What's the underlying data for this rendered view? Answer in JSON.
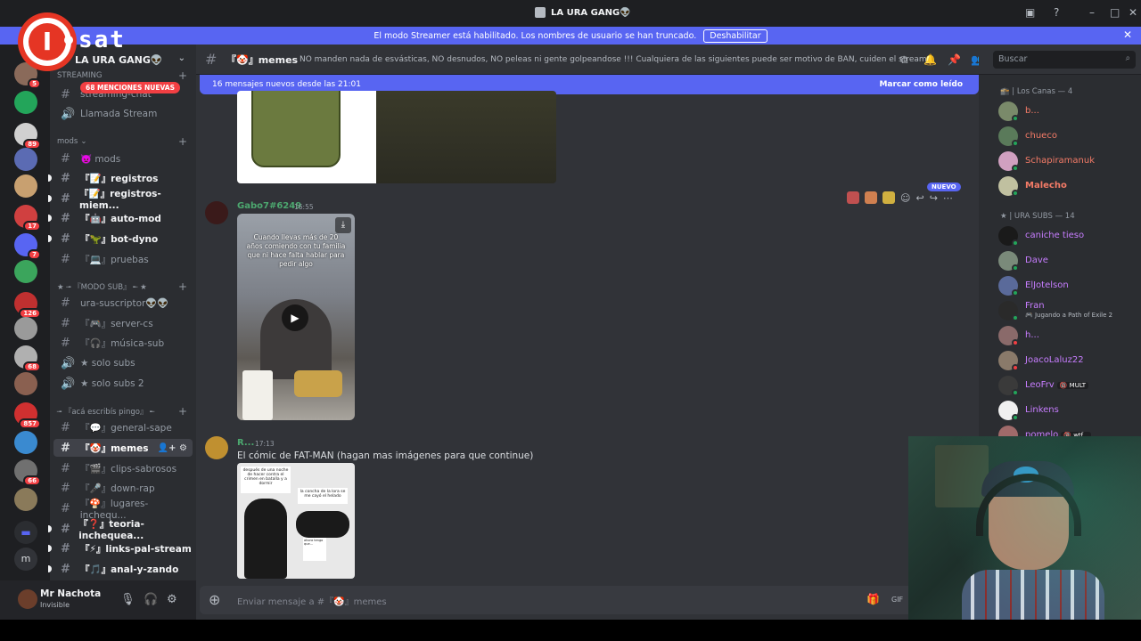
{
  "window": {
    "title": "LA URA GANG👽"
  },
  "banner": {
    "text": "El modo Streamer está habilitado. Los nombres de usuario se han truncado.",
    "button": "Deshabilitar"
  },
  "overlay_logo": {
    "letter": "I",
    "text": "sat"
  },
  "servers": [
    {
      "badge": "5",
      "color": "#8a6a5a"
    },
    {
      "badge": "",
      "color": "#23a55a"
    },
    {
      "badge": "89",
      "color": "#d0d0d0"
    },
    {
      "badge": "",
      "color": "#5b6bb3"
    },
    {
      "badge": "",
      "color": "#c8a070"
    },
    {
      "badge": "17",
      "color": "#d04040"
    },
    {
      "badge": "7",
      "color": "#5865f2"
    },
    {
      "badge": "",
      "color": "#3ba55c"
    },
    {
      "badge": "126",
      "color": "#c03030"
    },
    {
      "badge": "",
      "color": "#9a9a9a"
    },
    {
      "badge": "68",
      "color": "#b0b0b0"
    },
    {
      "badge": "",
      "color": "#8a6050"
    },
    {
      "badge": "857",
      "color": "#d03030"
    },
    {
      "badge": "",
      "color": "#3a8ad0"
    },
    {
      "badge": "66",
      "color": "#707070"
    },
    {
      "badge": "",
      "color": "#8a7a5a"
    }
  ],
  "sidebar": {
    "server_name": "LA URA GANG👽",
    "mentions_pill": "68 MENCIONES NUEVAS",
    "categories": {
      "streaming": "STREAMING",
      "mods": "mods",
      "modo_sub": "★ ╼ 『MODO SUB』 ╾ ★",
      "aca": "╼ 『acá escribís pingo』 ╾"
    },
    "channels": {
      "streaming_chat": "streaming-chat",
      "llamada_stream": "Llamada Stream",
      "mods": "👿 mods",
      "registros": "『📝』registros",
      "registros_miem": "『📝』registros-miem...",
      "auto_mod": "『🤖』auto-mod",
      "bot_dyno": "『🦖』bot-dyno",
      "pruebas": "『💻』pruebas",
      "ura_suscriptor": "ura-suscriptor👽👽",
      "server_cs": "『🎮』server-cs",
      "musica_sub": "『🎧』música-sub",
      "solo_subs": "★ solo subs",
      "solo_subs_2": "★ solo subs 2",
      "general_sape": "『💬』general-sape",
      "memes": "『🤡』memes",
      "clips_sabrosos": "『🎬』clips-sabrosos",
      "down_rap": "『🎤』down-rap",
      "lugares": "『🍄』lugares-inchequ...",
      "teoria": "『❓』teoria-inchequea...",
      "links": "『⚡』links-pal-stream",
      "anal": "『🎵』anal-y-zando"
    }
  },
  "user": {
    "name": "Mr Nachota",
    "status": "Invisible"
  },
  "header": {
    "channel": "『🤡』memes",
    "topic": "NO manden nada de esvásticas, NO desnudos, NO peleas ni gente golpeandose !!! Cualquiera de las siguientes puede ser motivo de BAN, cuiden el stream!",
    "search_placeholder": "Buscar"
  },
  "new_messages": {
    "text": "16 mensajes nuevos desde las 21:01",
    "mark_read": "Marcar como leído"
  },
  "messages": [
    {
      "author": "Gabo7#6249",
      "time": "16:55",
      "video_caption": "Cuando llevas más de 20 años comiendo con tu familia que ni hace falta hablar para pedir algo",
      "new_label": "NUEVO"
    },
    {
      "author": "R...",
      "time": "17:13",
      "text": "El cómic de FAT-MAN (hagan mas imágenes para que continue)",
      "comic_panel1": "después de una noche de hacer contra el crimen en batalla y a dormir",
      "comic_panel2": "la concha de la lora se me cayó el helado",
      "comic_panel3": "ahora tengo que..."
    }
  ],
  "composer": {
    "placeholder": "Enviar mensaje a #『🤡』memes"
  },
  "members": {
    "groups": [
      {
        "label": "🕋 | Los Canas — 4"
      },
      {
        "label": "★ | URA SUBS — 14"
      }
    ],
    "list": [
      {
        "name": "b...",
        "color": "#f47b67",
        "avatar": "#7a8a6a",
        "status": "#23a55a",
        "sub": "",
        "tag": ""
      },
      {
        "name": "chueco",
        "color": "#f47b67",
        "avatar": "#5a7a5a",
        "status": "#23a55a",
        "sub": "",
        "tag": ""
      },
      {
        "name": "Schapiramanuk",
        "color": "#f47b67",
        "avatar": "#d0a0c0",
        "status": "#23a55a",
        "sub": "",
        "tag": ""
      },
      {
        "name": "Malecho",
        "color": "#f47b67",
        "avatar": "#c0c0a0",
        "status": "#23a55a",
        "sub": "",
        "tag": ""
      },
      {
        "name": "caniche tieso",
        "color": "#c77dff",
        "avatar": "#1a1a1a",
        "status": "#23a55a",
        "sub": "",
        "tag": ""
      },
      {
        "name": "Dave",
        "color": "#c77dff",
        "avatar": "#7a8a7a",
        "status": "#23a55a",
        "sub": "",
        "tag": ""
      },
      {
        "name": "ElJotelson",
        "color": "#c77dff",
        "avatar": "#5a6a9a",
        "status": "#23a55a",
        "sub": "",
        "tag": ""
      },
      {
        "name": "Fran",
        "color": "#c77dff",
        "avatar": "#2a2a2a",
        "status": "#23a55a",
        "sub": "🎮 Jugando a Path of Exile 2",
        "tag": ""
      },
      {
        "name": "h...",
        "color": "#c77dff",
        "avatar": "#8a6a6a",
        "status": "#f23f43",
        "sub": "",
        "tag": ""
      },
      {
        "name": "JoacoLaluz22",
        "color": "#c77dff",
        "avatar": "#8a7a6a",
        "status": "#f23f43",
        "sub": "",
        "tag": ""
      },
      {
        "name": "LeoFrv",
        "color": "#c77dff",
        "avatar": "#3a3a3a",
        "status": "#23a55a",
        "sub": "",
        "tag": "🔞 MULT"
      },
      {
        "name": "Linkens",
        "color": "#c77dff",
        "avatar": "#f0f0f0",
        "status": "#23a55a",
        "sub": "",
        "tag": ""
      },
      {
        "name": "pomelo",
        "color": "#c77dff",
        "avatar": "#a06a6a",
        "status": "#f23f43",
        "sub": "",
        "tag": "🔞 wtf..."
      }
    ]
  },
  "colors": {
    "accent": "#5865f2",
    "bg_main": "#313338",
    "bg_sidebar": "#2b2d31",
    "bg_servers": "#1e1f22"
  },
  "icons": {
    "threads": "threads-icon",
    "bell": "bell-icon",
    "pin": "pin-icon",
    "members": "members-icon",
    "mic": "mic-icon",
    "headphones": "headphones-icon",
    "gear": "gear-icon",
    "gift": "gift-icon",
    "gif": "gif-icon",
    "download": "download-icon",
    "play": "play-icon",
    "search": "search-icon"
  }
}
